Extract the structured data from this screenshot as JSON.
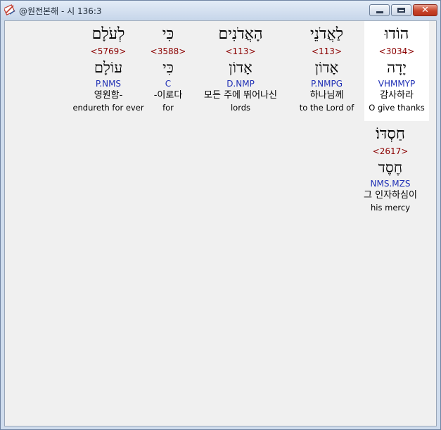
{
  "window": {
    "title": "@원전본해 - 시 136:3",
    "minimize_icon": "minimize-icon",
    "maximize_icon": "maximize-icon",
    "close_icon": "close-icon",
    "close_glyph": "✕"
  },
  "words": [
    {
      "hebrew": "הוֹדוּ",
      "strong": "<3034>",
      "lemma": "יָדָה",
      "parse": "VHMMYP",
      "korean": "감사하라",
      "english": "O give thanks"
    },
    {
      "hebrew": "לַאֲדֹנֵי",
      "strong": "<113>",
      "lemma": "אָדוֹן",
      "parse": "P.NMPG",
      "korean": "하나님께",
      "english": "to the Lord of"
    },
    {
      "hebrew": "הָאֲדֹנִים",
      "strong": "<113>",
      "lemma": "אָדוֹן",
      "parse": "D.NMP",
      "korean": "모든 주에 뛰어나신",
      "english": "lords"
    },
    {
      "hebrew": "כִּי",
      "strong": "<3588>",
      "lemma": "כִּי",
      "parse": "C",
      "korean": "-이로다",
      "english": "for"
    },
    {
      "hebrew": "לְעֹלָם",
      "strong": "<5769>",
      "lemma": "עוֹלָם",
      "parse": "P.NMS",
      "korean": "영원함-",
      "english": "endureth for ever"
    },
    {
      "hebrew": "חַסְדּוֹ׃",
      "strong": "<2617>",
      "lemma": "חֶסֶד",
      "parse": "NMS.MZS",
      "korean": "그 인자하심이",
      "english": "his mercy"
    }
  ]
}
